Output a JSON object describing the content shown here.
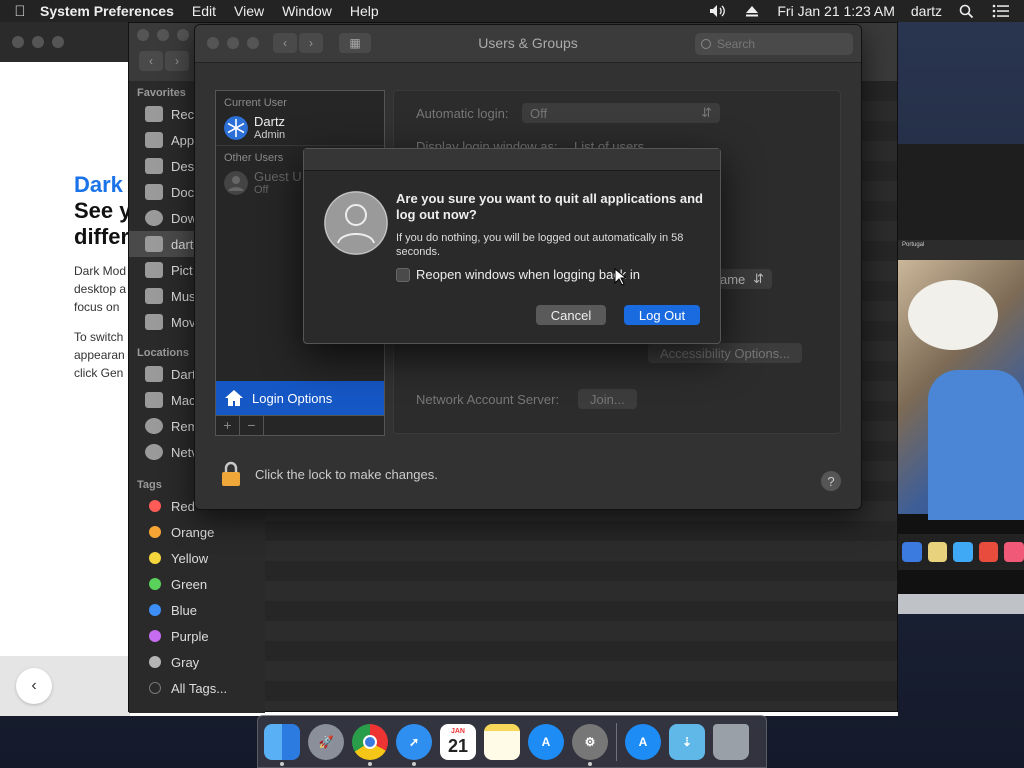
{
  "menubar": {
    "app_name": "System Preferences",
    "menus": [
      "Edit",
      "View",
      "Window",
      "Help"
    ],
    "datetime": "Fri Jan 21  1:23 AM",
    "user": "dartz"
  },
  "browser": {
    "heading_blue": "Dark",
    "heading_line1": "See y",
    "heading_line2": "differ",
    "para1": "Dark Mod desktop a focus on",
    "para2": "To switch appearan click Gen"
  },
  "finder": {
    "favorites_header": "Favorites",
    "favorites": [
      "Rece",
      "App",
      "Des",
      "Doc",
      "Dow",
      "dart",
      "Pict",
      "Mus",
      "Mov"
    ],
    "locations_header": "Locations",
    "locations": [
      "Dart",
      "Mac",
      "Rem",
      "Netv"
    ],
    "tags_header": "Tags",
    "tags": [
      {
        "label": "Red",
        "color": "#ff5b57"
      },
      {
        "label": "Orange",
        "color": "#f7a534"
      },
      {
        "label": "Yellow",
        "color": "#f5d63c"
      },
      {
        "label": "Green",
        "color": "#5ad15a"
      },
      {
        "label": "Blue",
        "color": "#3d8ef7"
      },
      {
        "label": "Purple",
        "color": "#c56cf0"
      },
      {
        "label": "Gray",
        "color": "#b5b5b5"
      },
      {
        "label": "All Tags...",
        "color": "#555555"
      }
    ]
  },
  "sysprefs": {
    "window_title": "Users & Groups",
    "search_placeholder": "Search",
    "current_user_header": "Current User",
    "current_user_name": "Dartz",
    "current_user_role": "Admin",
    "other_users_header": "Other Users",
    "guest_name": "Guest U",
    "guest_status": "Off",
    "login_options": "Login Options",
    "add_btn": "+",
    "remove_btn": "−",
    "automatic_login_label": "Automatic login:",
    "automatic_login_value": "Off",
    "display_login_label": "Display login window as:",
    "display_login_value": "List of users",
    "show_name_value": "ame",
    "accessibility_options": "Accessibility Options...",
    "network_account_label": "Network Account Server:",
    "join_button": "Join...",
    "lock_text": "Click the lock to make changes.",
    "help": "?"
  },
  "dialog": {
    "title": "Are you sure you want to quit all applications and log out now?",
    "info": "If you do nothing, you will be logged out automatically in 58 seconds.",
    "checkbox_label": "Reopen windows when logging back in",
    "checkbox_checked": false,
    "cancel": "Cancel",
    "logout": "Log Out"
  },
  "photo": {
    "header": "Portugal"
  },
  "dock": {
    "calendar_day": "21",
    "calendar_month": "JAN",
    "icons": [
      "finder-icon",
      "launchpad-icon",
      "chrome-icon",
      "safari-icon",
      "calendar-icon",
      "notes-icon",
      "app-store-icon",
      "system-preferences-icon",
      "app-store-download-icon",
      "downloads-folder-icon",
      "trash-icon"
    ]
  }
}
